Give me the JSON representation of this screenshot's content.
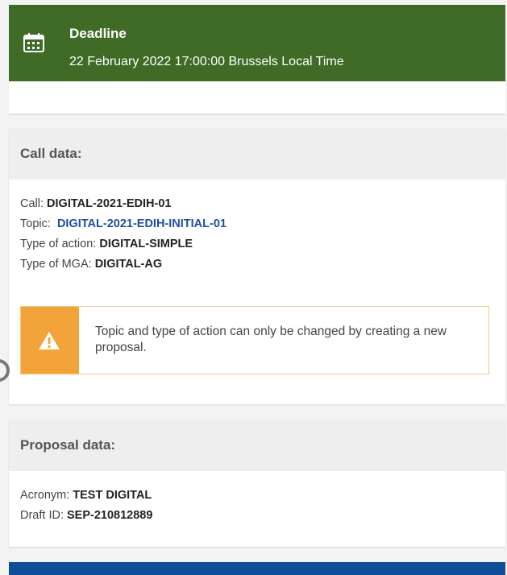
{
  "deadline": {
    "title": "Deadline",
    "text": "22 February 2022 17:00:00 Brussels Local Time",
    "icon": "calendar-icon"
  },
  "call_data": {
    "header": "Call data:",
    "call_label": "Call:",
    "call_value": "DIGITAL-2021-EDIH-01",
    "topic_label": "Topic:",
    "topic_value": "DIGITAL-2021-EDIH-INITIAL-01",
    "action_label": "Type of action:",
    "action_value": "DIGITAL-SIMPLE",
    "mga_label": "Type of MGA:",
    "mga_value": "DIGITAL-AG",
    "warning": {
      "icon": "warning-icon",
      "text": "Topic and type of action can only be changed by creating a new proposal."
    }
  },
  "proposal_data": {
    "header": "Proposal data:",
    "acronym_label": "Acronym:",
    "acronym_value": "TEST DIGITAL",
    "draft_label": "Draft ID:",
    "draft_value": "SEP-210812889"
  },
  "colors": {
    "deadline_bg": "#3f6b27",
    "warning_accent": "#f2a33a",
    "link": "#1f4ea1",
    "bottom_bar": "#0d4e96"
  }
}
